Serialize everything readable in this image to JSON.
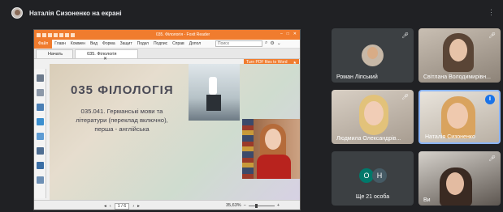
{
  "topbar": {
    "presenter_label": "Наталія Сизоненко на екрані",
    "menu_glyph": "⋮"
  },
  "reader": {
    "title": "035. Філологія - Foxit Reader",
    "menu": [
      "Файл",
      "Главн",
      "Коммен",
      "Вид",
      "Форма",
      "Защит",
      "Подкл",
      "Подпис",
      "Справ",
      "Допол"
    ],
    "search_placeholder": "Поиск",
    "tabs": [
      "Начать",
      "035. Філологія"
    ],
    "pdf_banner": "Turn PDF files to Word",
    "page_heading": "035 ФІЛОЛОГІЯ",
    "page_body": "035.041. Германські мови та літератури (переклад включно), перша - англійська",
    "page_indicator": "1 / 6",
    "zoom_level": "35,63%"
  },
  "participants": [
    {
      "name": "Роман Ліпський",
      "muted": true
    },
    {
      "name": "Світлана Володимирівн...",
      "muted": true
    },
    {
      "name": "Людмила Олександрів...",
      "muted": true
    },
    {
      "name": "Наталія Сизоненко",
      "muted": false
    },
    {
      "name": "Ще 21 особа",
      "initials": [
        "О",
        "Н"
      ]
    },
    {
      "name": "Ви",
      "muted": true
    }
  ],
  "colors": {
    "accent": "#f07c2e",
    "background": "#202124",
    "speaking": "#1a73e8"
  }
}
